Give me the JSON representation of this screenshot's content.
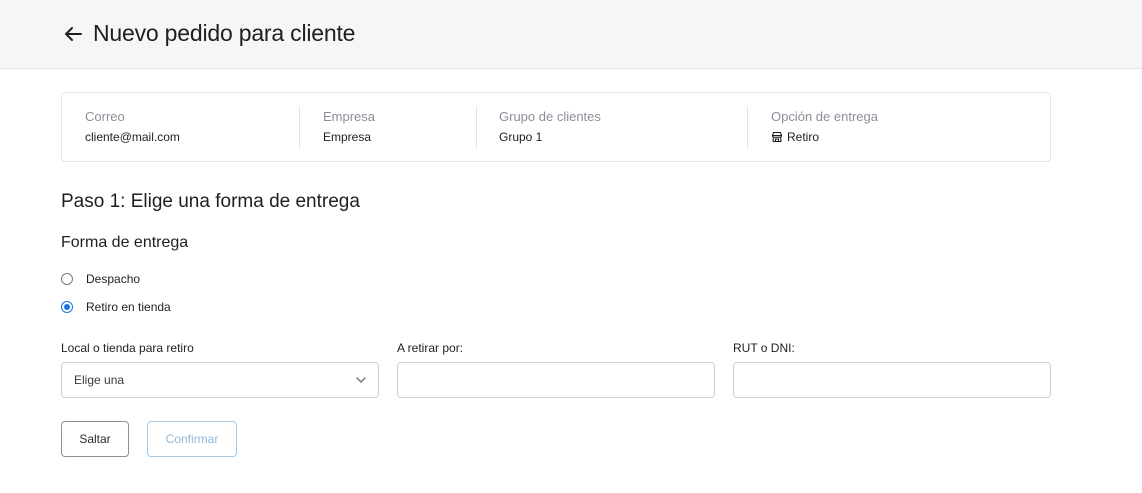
{
  "header": {
    "title": "Nuevo pedido para cliente",
    "back_icon": "arrow-left-icon"
  },
  "summary": {
    "email": {
      "label": "Correo",
      "value": "cliente@mail.com"
    },
    "company": {
      "label": "Empresa",
      "value": "Empresa"
    },
    "group": {
      "label": "Grupo de clientes",
      "value": "Grupo 1"
    },
    "delivery": {
      "label": "Opción de entrega",
      "value": "Retiro",
      "icon": "store-icon"
    }
  },
  "step": {
    "title": "Paso 1: Elige una forma de entrega",
    "section_title": "Forma de entrega",
    "options": [
      {
        "label": "Despacho",
        "checked": false
      },
      {
        "label": "Retiro en tienda",
        "checked": true
      }
    ]
  },
  "fields": {
    "store": {
      "label": "Local o tienda para retiro",
      "value": "Elige una"
    },
    "pickup_by": {
      "label": "A retirar por:",
      "value": ""
    },
    "rut": {
      "label": "RUT o DNI:",
      "value": ""
    }
  },
  "actions": {
    "skip_label": "Saltar",
    "confirm_label": "Confirmar"
  },
  "colors": {
    "accent": "#1a73e8",
    "confirm_border": "#a9c8e2",
    "header_bg": "#f6f6f8"
  }
}
